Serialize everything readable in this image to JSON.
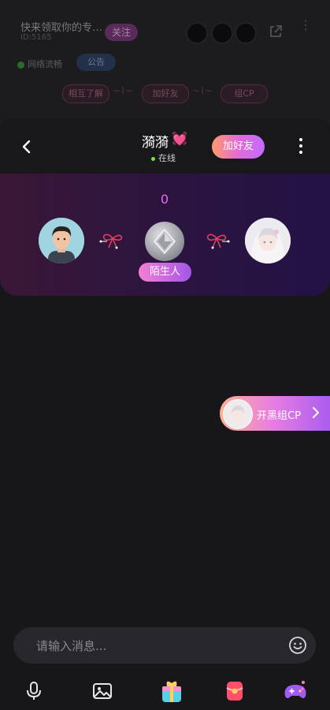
{
  "background_room": {
    "title": "快来领取你的专…",
    "id_line": "ID:5165",
    "follow_label": "关注",
    "network_label": "网络流畅",
    "notice_label": "公告",
    "tag_pills": [
      "相互了解",
      "加好友",
      "组CP"
    ]
  },
  "header": {
    "nickname": "漪漪",
    "heart": "💓",
    "status": "在线",
    "add_friend_label": "加好友"
  },
  "intimacy": {
    "score": "0",
    "relation_label": "陌生人"
  },
  "floating_cp": {
    "label": "开黑组CP"
  },
  "input": {
    "placeholder": "请输入消息..."
  },
  "toolbar": {
    "items": [
      "mic-icon",
      "image-icon",
      "gift-box-icon",
      "red-packet-icon",
      "game-controller-icon"
    ]
  },
  "colors": {
    "accent_pink": "#e56cf0",
    "online_green": "#7ddf4b",
    "page_bg": "#17171a"
  }
}
